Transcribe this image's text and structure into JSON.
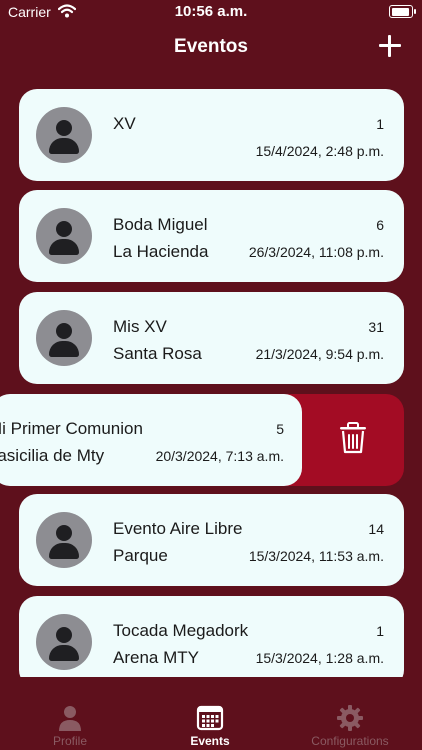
{
  "status": {
    "carrier": "Carrier",
    "time": "10:56 a.m.",
    "battery_level": 1.0
  },
  "nav": {
    "title": "Eventos",
    "add_icon": "plus-icon"
  },
  "events": [
    {
      "name": "XV",
      "location": "",
      "count": "1",
      "date": "15/4/2024, 2:48 p.m."
    },
    {
      "name": "Boda Miguel",
      "location": "La Hacienda",
      "count": "6",
      "date": "26/3/2024, 11:08 p.m."
    },
    {
      "name": "Mis XV",
      "location": "Santa Rosa",
      "count": "31",
      "date": "21/3/2024, 9:54 p.m."
    },
    {
      "name": "Mi Primer Comunion",
      "location": "Basicilia de Mty",
      "count": "5",
      "date": "20/3/2024, 7:13 a.m."
    },
    {
      "name": "Evento Aire Libre",
      "location": "Parque",
      "count": "14",
      "date": "15/3/2024, 11:53 a.m."
    },
    {
      "name": "Tocada Megadork",
      "location": "Arena MTY",
      "count": "1",
      "date": "15/3/2024, 1:28 a.m."
    }
  ],
  "swipe_action": {
    "icon": "trash-icon",
    "color": "#a30c24"
  },
  "tabs": [
    {
      "label": "Profile",
      "icon": "person-icon",
      "active": false
    },
    {
      "label": "Events",
      "icon": "calendar-icon",
      "active": true
    },
    {
      "label": "Configurations",
      "icon": "gear-icon",
      "active": false
    }
  ],
  "colors": {
    "background": "#5e101c",
    "card": "#effcfc",
    "delete": "#a30c24"
  }
}
